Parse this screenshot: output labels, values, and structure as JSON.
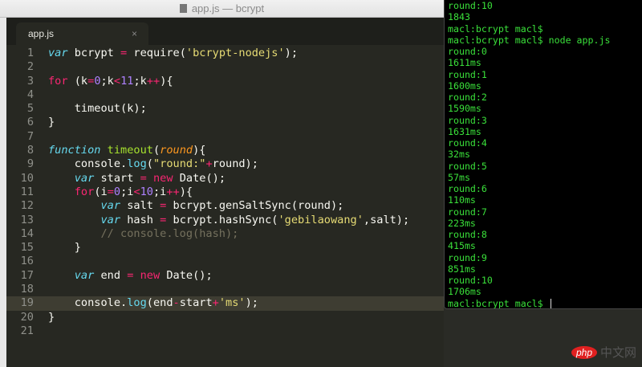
{
  "window": {
    "title": "app.js — bcrypt"
  },
  "tab": {
    "label": "app.js",
    "close": "×"
  },
  "editor": {
    "current_line": 19,
    "lines": [
      [
        [
          "var",
          "kw"
        ],
        [
          " bcrypt ",
          ""
        ],
        [
          "=",
          "op"
        ],
        [
          " require(",
          ""
        ],
        [
          "'bcrypt-nodejs'",
          "str"
        ],
        [
          ");",
          ""
        ]
      ],
      [],
      [
        [
          "for",
          "op"
        ],
        [
          " (k",
          ""
        ],
        [
          "=",
          "op"
        ],
        [
          "0",
          "num"
        ],
        [
          ";k",
          ""
        ],
        [
          "<",
          "op"
        ],
        [
          "11",
          "num"
        ],
        [
          ";k",
          ""
        ],
        [
          "++",
          "op"
        ],
        [
          "){",
          ""
        ]
      ],
      [],
      [
        [
          "    timeout(k);",
          ""
        ]
      ],
      [
        [
          "}",
          ""
        ]
      ],
      [],
      [
        [
          "function",
          "kw"
        ],
        [
          " ",
          ""
        ],
        [
          "timeout",
          "fn"
        ],
        [
          "(",
          ""
        ],
        [
          "round",
          "par"
        ],
        [
          "){",
          ""
        ]
      ],
      [
        [
          "    console.",
          ""
        ],
        [
          "log",
          "bi"
        ],
        [
          "(",
          ""
        ],
        [
          "\"round:\"",
          "str"
        ],
        [
          "+",
          "op"
        ],
        [
          "round);",
          ""
        ]
      ],
      [
        [
          "    ",
          ""
        ],
        [
          "var",
          "kw"
        ],
        [
          " start ",
          ""
        ],
        [
          "=",
          "op"
        ],
        [
          " ",
          ""
        ],
        [
          "new",
          "op"
        ],
        [
          " Date();",
          ""
        ]
      ],
      [
        [
          "    ",
          ""
        ],
        [
          "for",
          "op"
        ],
        [
          "(i",
          ""
        ],
        [
          "=",
          "op"
        ],
        [
          "0",
          "num"
        ],
        [
          ";i",
          ""
        ],
        [
          "<",
          "op"
        ],
        [
          "10",
          "num"
        ],
        [
          ";i",
          ""
        ],
        [
          "++",
          "op"
        ],
        [
          "){",
          ""
        ]
      ],
      [
        [
          "        ",
          ""
        ],
        [
          "var",
          "kw"
        ],
        [
          " salt ",
          ""
        ],
        [
          "=",
          "op"
        ],
        [
          " bcrypt.genSaltSync(round);",
          ""
        ]
      ],
      [
        [
          "        ",
          ""
        ],
        [
          "var",
          "kw"
        ],
        [
          " hash ",
          ""
        ],
        [
          "=",
          "op"
        ],
        [
          " bcrypt.hashSync(",
          ""
        ],
        [
          "'gebilaowang'",
          "str"
        ],
        [
          ",salt);",
          ""
        ]
      ],
      [
        [
          "        // console.log(hash);",
          "cm"
        ]
      ],
      [
        [
          "    }",
          ""
        ]
      ],
      [],
      [
        [
          "    ",
          ""
        ],
        [
          "var",
          "kw"
        ],
        [
          " end ",
          ""
        ],
        [
          "=",
          "op"
        ],
        [
          " ",
          ""
        ],
        [
          "new",
          "op"
        ],
        [
          " Date();",
          ""
        ]
      ],
      [],
      [
        [
          "    console.",
          ""
        ],
        [
          "log",
          "bi"
        ],
        [
          "(end",
          ""
        ],
        [
          "-",
          "op"
        ],
        [
          "start",
          ""
        ],
        [
          "+",
          "op"
        ],
        [
          "'ms'",
          "str"
        ],
        [
          ");",
          ""
        ]
      ],
      [
        [
          "}",
          ""
        ]
      ],
      []
    ]
  },
  "terminal": {
    "lines": [
      "round:10",
      "1843",
      "macl:bcrypt macl$",
      "macl:bcrypt macl$ node app.js",
      "round:0",
      "1611ms",
      "round:1",
      "1600ms",
      "round:2",
      "1590ms",
      "round:3",
      "1631ms",
      "round:4",
      "32ms",
      "round:5",
      "57ms",
      "round:6",
      "110ms",
      "round:7",
      "223ms",
      "round:8",
      "415ms",
      "round:9",
      "851ms",
      "round:10",
      "1706ms"
    ],
    "prompt": "macl:bcrypt macl$ "
  },
  "watermark": {
    "php": "php",
    "cn": "中文网"
  }
}
